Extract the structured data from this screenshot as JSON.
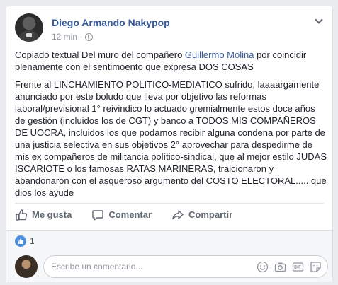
{
  "post": {
    "author": "Diego Armando Nakypop",
    "timestamp": "12 min",
    "separator": "·",
    "privacy_icon": "globe-icon",
    "menu_icon": "chevron-down-icon",
    "intro_prefix": "Copiado textual Del muro del compañero ",
    "intro_link": "Guillermo Molina",
    "intro_suffix": " por coincidir plenamente con el sentimoento que expresa DOS COSAS",
    "body": "Frente al LINCHAMIENTO POLITICO-MEDIATICO sufrido, laaaargamente anunciado por este boludo que lleva por objetivo las reformas laboral/previsional 1° reivindico lo actuado gremialmente estos doce años de gestión (incluidos los de CGT) y banco a TODOS MIS COMPAÑEROS DE UOCRA, incluidos los que podamos recibir alguna condena por parte de una justicia selectiva en sus objetivos 2° aprovechar para despedirme de mis ex compañeros de militancia político-sindical, que al mejor estilo JUDAS ISCARIOTE o los famosas RATAS MARINERAS, traicionaron y abandonaron con el asqueroso argumento del COSTO ELECTORAL..... que dios los ayude"
  },
  "actions": {
    "like": "Me gusta",
    "comment": "Comentar",
    "share": "Compartir"
  },
  "reactions": {
    "count": "1",
    "icon": "like-icon",
    "color": "#4a90e2"
  },
  "comment_input": {
    "placeholder": "Escribe un comentario...",
    "icons": [
      "smiley-icon",
      "camera-icon",
      "gif-icon",
      "sticker-icon"
    ]
  },
  "colors": {
    "link": "#365899",
    "muted": "#90949c",
    "text": "#1d2129",
    "action": "#616770"
  }
}
